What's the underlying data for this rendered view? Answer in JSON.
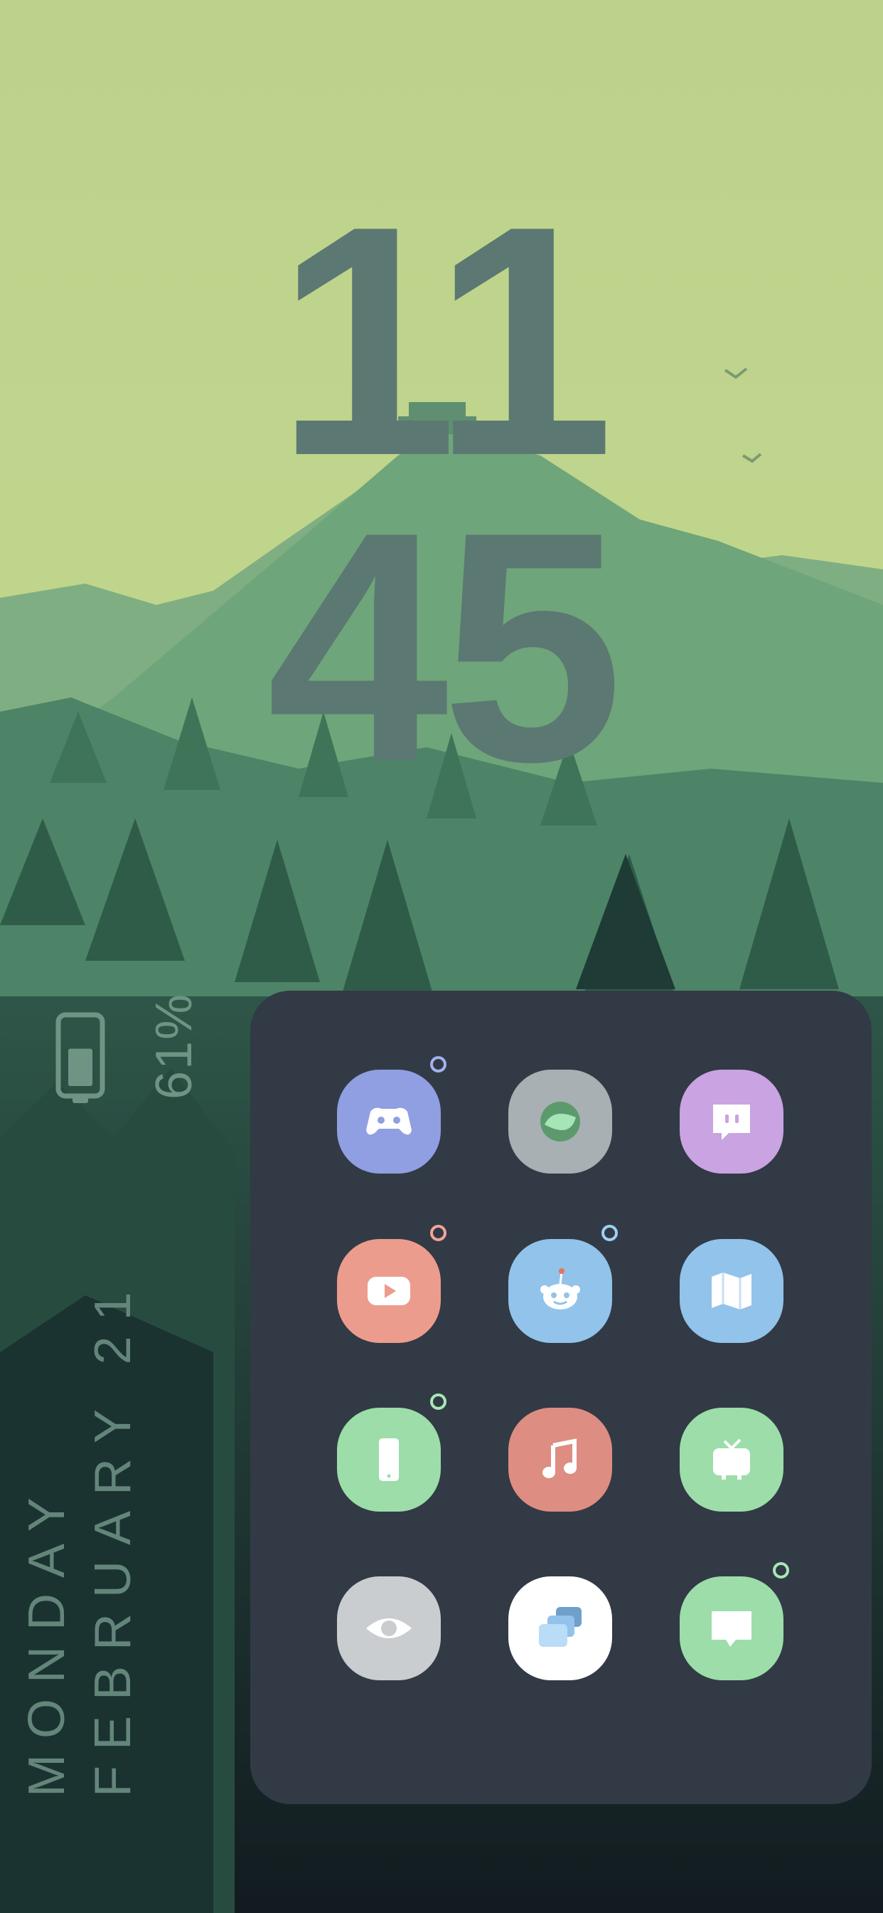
{
  "clock": {
    "hours": "11",
    "minutes": "45"
  },
  "battery": {
    "percent_text": "61%",
    "level": 0.61
  },
  "date": {
    "weekday": "MONDAY",
    "month_day": "FEBRUARY 21"
  },
  "colors": {
    "sky_top": "#bcd28b",
    "clock_text": "#5b7872",
    "panel_bg": "#323a45",
    "discord": "#8f9fe1",
    "google_one": "#a9b0b4",
    "twitch": "#c9a3e2",
    "youtube": "#ec9c8d",
    "reddit": "#92c3ea",
    "maps": "#92c3ea",
    "phone": "#9cddaa",
    "music": "#de8d82",
    "tv": "#9cddaa",
    "eye": "#c9cdd0",
    "multitask": "#ffffff",
    "messages": "#9cddaa"
  },
  "apps": [
    {
      "name": "discord",
      "icon": "gamepad-icon",
      "notification": true
    },
    {
      "name": "google-one",
      "icon": "circle-leaf-icon",
      "notification": false
    },
    {
      "name": "twitch",
      "icon": "chat-face-icon",
      "notification": false
    },
    {
      "name": "youtube",
      "icon": "play-icon",
      "notification": true
    },
    {
      "name": "reddit",
      "icon": "reddit-alien-icon",
      "notification": true
    },
    {
      "name": "maps",
      "icon": "map-icon",
      "notification": false
    },
    {
      "name": "phone",
      "icon": "smartphone-icon",
      "notification": true
    },
    {
      "name": "music",
      "icon": "music-note-icon",
      "notification": false
    },
    {
      "name": "tv",
      "icon": "tv-icon",
      "notification": false
    },
    {
      "name": "eye",
      "icon": "eye-icon",
      "notification": false
    },
    {
      "name": "multitask",
      "icon": "stacked-windows-icon",
      "notification": false
    },
    {
      "name": "messages",
      "icon": "message-bubble-icon",
      "notification": true
    }
  ]
}
